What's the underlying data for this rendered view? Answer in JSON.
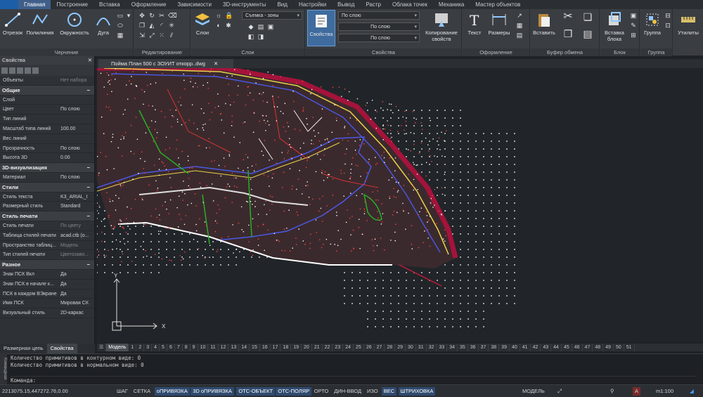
{
  "menu": [
    "Главная",
    "Построение",
    "Вставка",
    "Оформление",
    "Зависимости",
    "3D-инструменты",
    "Вид",
    "Настройки",
    "Вывод",
    "Растр",
    "Облака точек",
    "Механика",
    "Мастер объектов"
  ],
  "ribbon": {
    "draw": {
      "label": "Черчение",
      "segment": "Отрезок",
      "polyline": "Полилиния",
      "circle": "Окружность",
      "arc": "Дуга"
    },
    "edit": {
      "label": "Редактирование"
    },
    "layers": {
      "label": "Слои",
      "button": "Слои",
      "layer_value": "Съемка - зоны"
    },
    "props": {
      "label": "Свойства",
      "button": "Свойства",
      "by_layer_1": "По слою",
      "by_layer_2": "По слою",
      "by_layer_3": "По слою",
      "copy_props": "Копирование свойств"
    },
    "annot": {
      "label": "Оформление",
      "text": "Текст",
      "dims": "Размеры"
    },
    "clip": {
      "label": "Буфер обмена",
      "paste": "Вставить"
    },
    "block": {
      "label": "Блок",
      "insert": "Вставка блока"
    },
    "group": {
      "label": "Группа",
      "button": "Группа"
    },
    "utils": {
      "button": "Утилиты"
    }
  },
  "props_panel": {
    "title": "Свойства",
    "objects_label": "Объекты",
    "objects_value": "Нет набора",
    "sections": [
      {
        "name": "Общие",
        "rows": [
          [
            "Слой",
            ""
          ],
          [
            "Цвет",
            "По слою"
          ],
          [
            "Тип линий",
            ""
          ],
          [
            "Масштаб типа линий",
            "100.00"
          ],
          [
            "Вес линий",
            ""
          ],
          [
            "Прозрачность",
            "По слою"
          ],
          [
            "Высота 3D",
            "0.00"
          ]
        ]
      },
      {
        "name": "3D-визуализация",
        "rows": [
          [
            "Материал",
            "По слою"
          ]
        ]
      },
      {
        "name": "Стили",
        "rows": [
          [
            "Стиль текста",
            "K3_ARIAL_I"
          ],
          [
            "Размерный стиль",
            "Standard"
          ]
        ]
      },
      {
        "name": "Стиль печати",
        "rows": [
          [
            "Стиль печати",
            "По цвету"
          ],
          [
            "Таблица стилей печати",
            "acad.ctb (о..."
          ],
          [
            "Пространство таблиц...",
            "Модель"
          ],
          [
            "Тип стилей печати",
            "Цветозави..."
          ]
        ]
      },
      {
        "name": "Разное",
        "rows": [
          [
            "Знак ПСК Вкл",
            "Да"
          ],
          [
            "Знак ПСК в начале к...",
            "Да"
          ],
          [
            "ПСК в каждом ВЭкране",
            "Да"
          ],
          [
            "Имя ПСК",
            "Мировая СК"
          ],
          [
            "Визуальный стиль",
            "2D-каркас"
          ]
        ]
      }
    ],
    "tabs": [
      "Размерная цепь",
      "Свойства"
    ]
  },
  "doc": {
    "tab": "Пойма План 500 с ЗОУИТ откорр..dwg"
  },
  "ucs": {
    "y": "Y",
    "x": "X"
  },
  "layout_tabs": {
    "model": "Модель",
    "numbers": [
      "1",
      "2",
      "3",
      "4",
      "5",
      "6",
      "7",
      "8",
      "9",
      "10",
      "11",
      "12",
      "13",
      "14",
      "15",
      "16",
      "17",
      "18",
      "19",
      "20",
      "21",
      "22",
      "23",
      "24",
      "25",
      "26",
      "27",
      "28",
      "29",
      "30",
      "31",
      "32",
      "33",
      "34",
      "35",
      "36",
      "37",
      "38",
      "39",
      "40",
      "41",
      "42",
      "43",
      "44",
      "45",
      "46",
      "47",
      "48",
      "49",
      "50",
      "51"
    ]
  },
  "command": {
    "title": "Командная",
    "line1": "Количество примитивов в контурном виде: 0",
    "line2": "Количество примитивов в нормальном виде: 0",
    "prompt": "Команда:"
  },
  "status": {
    "coords": "2213075.15,447272.76,0.00",
    "buttons": [
      "ШАГ",
      "СЕТКА",
      "оПРИВЯЗКА",
      "3D оПРИВЯЗКА",
      "ОТС-ОБЪЕКТ",
      "ОТС-ПОЛЯР",
      "ОРТО",
      "ДИН-ВВОД",
      "ИЗО",
      "ВЕС",
      "ШТРИХОВКА"
    ],
    "on": [
      "оПРИВЯЗКА",
      "3D оПРИВЯЗКА",
      "ОТС-ОБЪЕКТ",
      "ОТС-ПОЛЯР",
      "ВЕС",
      "ШТРИХОВКА"
    ],
    "model": "МОДЕЛЬ",
    "scale": "m1:100"
  }
}
